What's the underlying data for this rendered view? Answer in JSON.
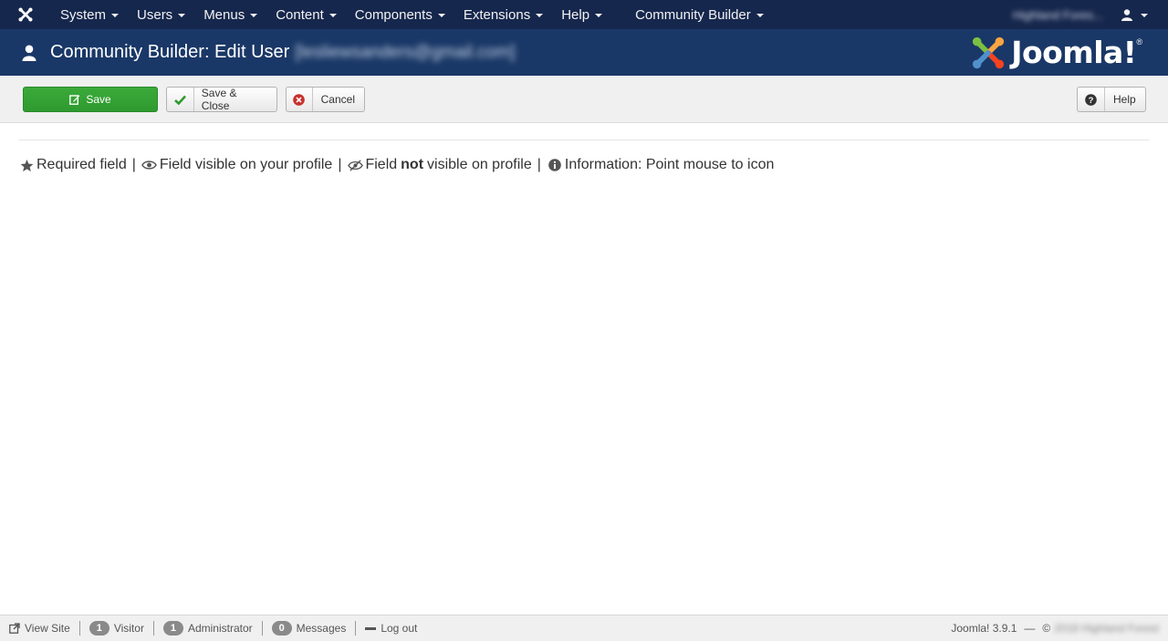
{
  "topnav": {
    "menu": [
      {
        "label": "System"
      },
      {
        "label": "Users"
      },
      {
        "label": "Menus"
      },
      {
        "label": "Content"
      },
      {
        "label": "Components"
      },
      {
        "label": "Extensions"
      },
      {
        "label": "Help"
      }
    ],
    "community_builder_label": "Community Builder",
    "site_name": "Highland Fores... ",
    "site_external_icon": "external-link-icon"
  },
  "header": {
    "title": "Community Builder: Edit User",
    "user_email": "[lesliewsanders@gmail.com]",
    "logo_text": "Joomla!",
    "logo_reg": "®"
  },
  "toolbar": {
    "save_label": "Save",
    "save_close_label": "Save & Close",
    "cancel_label": "Cancel",
    "help_label": "Help"
  },
  "legend": {
    "required": "Required field",
    "visible": "Field visible on your profile",
    "not_visible_pre": "Field",
    "not_visible_bold": "not",
    "not_visible_post": "visible on profile",
    "info": "Information: Point mouse to icon",
    "separator": "|"
  },
  "footer": {
    "view_site": "View Site",
    "visitor_count": "1",
    "visitor_label": "Visitor",
    "admin_count": "1",
    "admin_label": "Administrator",
    "messages_count": "0",
    "messages_label": "Messages",
    "logout": "Log out",
    "version": "Joomla! 3.9.1",
    "dash": "—",
    "copy_symbol": "©",
    "copyright": "2018 Highland Forest"
  },
  "colors": {
    "nav_bg": "#16274d",
    "header_bg": "#1a3867",
    "save_green": "#3aaa3a",
    "check_green": "#2f9a2f",
    "cancel_red": "#c9302c"
  }
}
